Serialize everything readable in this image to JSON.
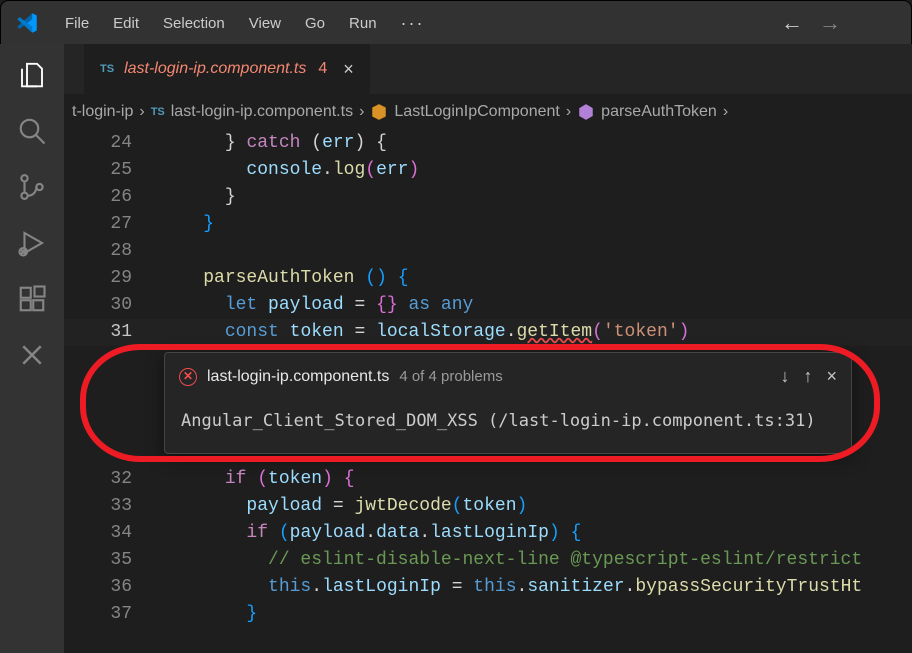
{
  "menu": [
    "File",
    "Edit",
    "Selection",
    "View",
    "Go",
    "Run"
  ],
  "tab": {
    "lang_badge": "TS",
    "name": "last-login-ip.component.ts",
    "problem_count": "4"
  },
  "breadcrumbs": {
    "items": [
      {
        "kind": "text",
        "label": "t-login-ip"
      },
      {
        "kind": "file",
        "badge": "TS",
        "label": "last-login-ip.component.ts"
      },
      {
        "kind": "class",
        "label": "LastLoginIpComponent"
      },
      {
        "kind": "method",
        "label": "parseAuthToken"
      }
    ]
  },
  "lines": [
    {
      "no": "24",
      "indent": 3,
      "tokens": [
        {
          "t": "}",
          "c": "c-punc"
        },
        {
          "t": " ",
          "c": "c-punc"
        },
        {
          "t": "catch",
          "c": "c-key2"
        },
        {
          "t": " (",
          "c": "c-punc"
        },
        {
          "t": "err",
          "c": "c-var"
        },
        {
          "t": ") {",
          "c": "c-punc"
        }
      ]
    },
    {
      "no": "25",
      "indent": 4,
      "tokens": [
        {
          "t": "console",
          "c": "c-var"
        },
        {
          "t": ".",
          "c": "c-punc"
        },
        {
          "t": "log",
          "c": "c-fn"
        },
        {
          "t": "(",
          "c": "c-punc-y"
        },
        {
          "t": "err",
          "c": "c-var"
        },
        {
          "t": ")",
          "c": "c-punc-y"
        }
      ]
    },
    {
      "no": "26",
      "indent": 3,
      "tokens": [
        {
          "t": "}",
          "c": "c-punc"
        }
      ]
    },
    {
      "no": "27",
      "indent": 2,
      "tokens": [
        {
          "t": "}",
          "c": "c-punc-b"
        }
      ]
    },
    {
      "no": "28",
      "indent": 0,
      "tokens": []
    },
    {
      "no": "29",
      "indent": 2,
      "tokens": [
        {
          "t": "parseAuthToken",
          "c": "c-fn"
        },
        {
          "t": " ",
          "c": "c-punc"
        },
        {
          "t": "(",
          "c": "c-punc-b"
        },
        {
          "t": ")",
          "c": "c-punc-b"
        },
        {
          "t": " ",
          "c": "c-punc"
        },
        {
          "t": "{",
          "c": "c-punc-b"
        }
      ]
    },
    {
      "no": "30",
      "indent": 3,
      "tokens": [
        {
          "t": "let",
          "c": "c-key"
        },
        {
          "t": " ",
          "c": "c-punc"
        },
        {
          "t": "payload",
          "c": "c-var"
        },
        {
          "t": " = ",
          "c": "c-punc"
        },
        {
          "t": "{",
          "c": "c-punc-y"
        },
        {
          "t": "}",
          "c": "c-punc-y"
        },
        {
          "t": " ",
          "c": "c-punc"
        },
        {
          "t": "as",
          "c": "c-key"
        },
        {
          "t": " ",
          "c": "c-punc"
        },
        {
          "t": "any",
          "c": "c-key"
        }
      ]
    },
    {
      "no": "31",
      "indent": 3,
      "current": true,
      "tokens": [
        {
          "t": "const",
          "c": "c-key"
        },
        {
          "t": " ",
          "c": "c-punc"
        },
        {
          "t": "token",
          "c": "c-var"
        },
        {
          "t": " = ",
          "c": "c-punc"
        },
        {
          "t": "localStorage",
          "c": "c-var"
        },
        {
          "t": ".",
          "c": "c-punc"
        },
        {
          "t": "getItem",
          "c": "c-fn c-bad"
        },
        {
          "t": "(",
          "c": "c-punc-y"
        },
        {
          "t": "'token'",
          "c": "c-str"
        },
        {
          "t": ")",
          "c": "c-punc-y"
        }
      ]
    }
  ],
  "popup": {
    "file": "last-login-ip.component.ts",
    "count": "4 of 4 problems",
    "message": "Angular_Client_Stored_DOM_XSS (/last-login-ip.component.ts:31)"
  },
  "lines_after": [
    {
      "no": "32",
      "indent": 3,
      "tokens": [
        {
          "t": "if",
          "c": "c-key2"
        },
        {
          "t": " ",
          "c": "c-punc"
        },
        {
          "t": "(",
          "c": "c-punc-y"
        },
        {
          "t": "token",
          "c": "c-var"
        },
        {
          "t": ")",
          "c": "c-punc-y"
        },
        {
          "t": " ",
          "c": "c-punc"
        },
        {
          "t": "{",
          "c": "c-punc-y"
        }
      ]
    },
    {
      "no": "33",
      "indent": 4,
      "tokens": [
        {
          "t": "payload",
          "c": "c-var"
        },
        {
          "t": " = ",
          "c": "c-punc"
        },
        {
          "t": "jwtDecode",
          "c": "c-fn"
        },
        {
          "t": "(",
          "c": "c-punc-b"
        },
        {
          "t": "token",
          "c": "c-var"
        },
        {
          "t": ")",
          "c": "c-punc-b"
        }
      ]
    },
    {
      "no": "34",
      "indent": 4,
      "tokens": [
        {
          "t": "if",
          "c": "c-key2"
        },
        {
          "t": " ",
          "c": "c-punc"
        },
        {
          "t": "(",
          "c": "c-punc-b"
        },
        {
          "t": "payload",
          "c": "c-var"
        },
        {
          "t": ".",
          "c": "c-punc"
        },
        {
          "t": "data",
          "c": "c-var"
        },
        {
          "t": ".",
          "c": "c-punc"
        },
        {
          "t": "lastLoginIp",
          "c": "c-var"
        },
        {
          "t": ")",
          "c": "c-punc-b"
        },
        {
          "t": " ",
          "c": "c-punc"
        },
        {
          "t": "{",
          "c": "c-punc-b"
        }
      ]
    },
    {
      "no": "35",
      "indent": 5,
      "tokens": [
        {
          "t": "// eslint-disable-next-line @typescript-eslint/restrict",
          "c": "c-comment"
        }
      ]
    },
    {
      "no": "36",
      "indent": 5,
      "tokens": [
        {
          "t": "this",
          "c": "c-key"
        },
        {
          "t": ".",
          "c": "c-punc"
        },
        {
          "t": "lastLoginIp",
          "c": "c-var"
        },
        {
          "t": " = ",
          "c": "c-punc"
        },
        {
          "t": "this",
          "c": "c-key"
        },
        {
          "t": ".",
          "c": "c-punc"
        },
        {
          "t": "sanitizer",
          "c": "c-var"
        },
        {
          "t": ".",
          "c": "c-punc"
        },
        {
          "t": "bypassSecurityTrustHt",
          "c": "c-fn"
        }
      ]
    },
    {
      "no": "37",
      "indent": 4,
      "tokens": [
        {
          "t": "}",
          "c": "c-punc-b"
        }
      ]
    }
  ],
  "activity_icons": [
    "explorer",
    "search",
    "source-control",
    "run-debug",
    "extensions",
    "close"
  ]
}
